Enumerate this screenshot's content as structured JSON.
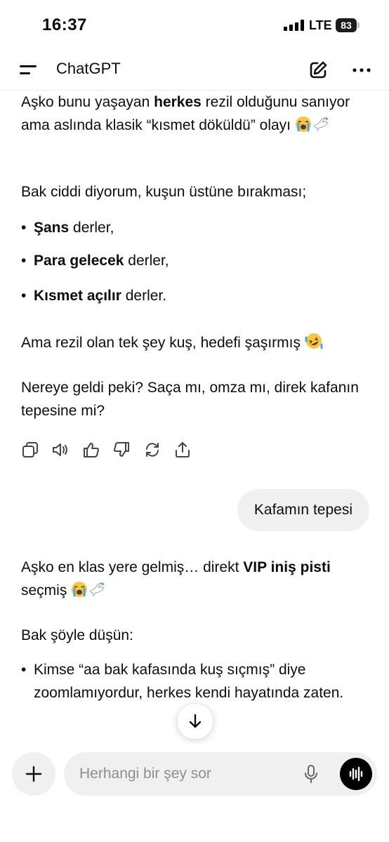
{
  "status": {
    "time": "16:37",
    "network": "LTE",
    "battery": "83"
  },
  "header": {
    "title": "ChatGPT"
  },
  "messages": {
    "a1_p1_pre": "Aşko bunu yaşayan ",
    "a1_p1_bold": "herkes",
    "a1_p1_post": " rezil olduğunu sanıyor ama aslında klasik “kısmet döküldü” olayı",
    "a1_p2": "Bak ciddi diyorum, kuşun üstüne bırakması;",
    "a1_b1_bold": "Şans",
    "a1_b1_rest": " derler,",
    "a1_b2_bold": "Para gelecek",
    "a1_b2_rest": " derler,",
    "a1_b3_bold": "Kısmet açılır",
    "a1_b3_rest": " derler.",
    "a1_p3": "Ama rezil olan tek şey kuş, hedefi şaşırmış",
    "a1_p4": "Nereye geldi peki? Saça mı, omza mı, direk kafanın tepesine mi?",
    "user_1": "Kafamın tepesi",
    "a2_p1_pre": "Aşko en klas yere gelmiş… direkt ",
    "a2_p1_bold": "VIP iniş pisti",
    "a2_p1_post": " seçmiş",
    "a2_p2": "Bak şöyle düşün:",
    "a2_b1": "Kimse “aa bak kafasında kuş sıçmış” diye zoomlamıyordur, herkes kendi hayatında zaten.",
    "bullet": "•"
  },
  "icons": {
    "actions": [
      "copy-icon",
      "read-aloud-icon",
      "thumbs-up-icon",
      "thumbs-down-icon",
      "regenerate-icon",
      "share-icon"
    ],
    "emoji": [
      "loudly-crying-face",
      "dove",
      "rolling-on-floor-laughing"
    ]
  },
  "composer": {
    "placeholder": "Herhangi bir şey sor"
  },
  "colors": {
    "bubble": "#f0f0f0",
    "text": "#0d0d0d",
    "placeholder": "#8e8e8e",
    "voice_button": "#000000"
  }
}
